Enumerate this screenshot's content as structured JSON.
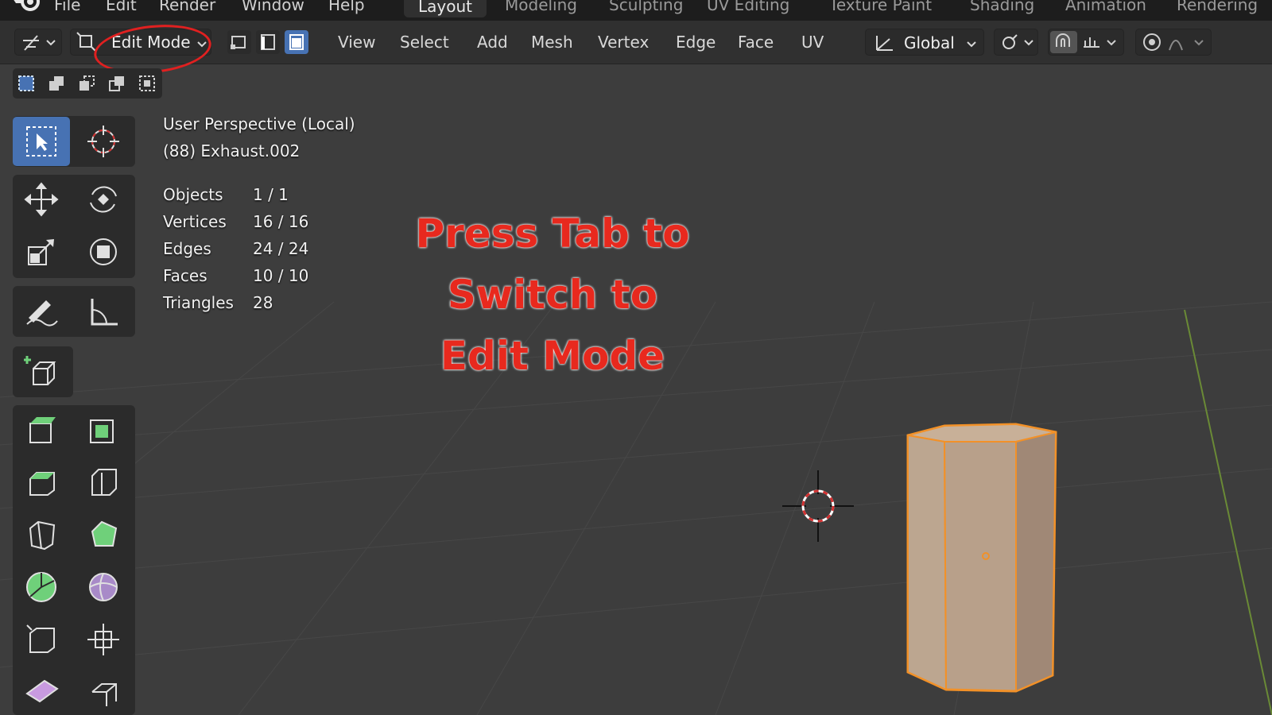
{
  "topbar": {
    "menus": [
      "File",
      "Edit",
      "Render",
      "Window",
      "Help"
    ],
    "workspaces": [
      "Layout",
      "Modeling",
      "Sculpting",
      "UV Editing",
      "Texture Paint",
      "Shading",
      "Animation",
      "Rendering"
    ],
    "active_workspace": "Layout"
  },
  "header": {
    "mode": "Edit Mode",
    "menus": [
      "View",
      "Select",
      "Add",
      "Mesh",
      "Vertex",
      "Edge",
      "Face",
      "UV"
    ],
    "transform_orientation": "Global"
  },
  "overlay": {
    "view_name": "User Perspective (Local)",
    "object_name": "(88) Exhaust.002",
    "stats": [
      {
        "label": "Objects",
        "value": "1 / 1"
      },
      {
        "label": "Vertices",
        "value": "16 / 16"
      },
      {
        "label": "Edges",
        "value": "24 / 24"
      },
      {
        "label": "Faces",
        "value": "10 / 10"
      },
      {
        "label": "Triangles",
        "value": "28"
      }
    ]
  },
  "annotation": {
    "lines": [
      "Press Tab to",
      "Switch to",
      "Edit Mode"
    ],
    "color": "#e8291e"
  },
  "colors": {
    "accent": "#4772b3",
    "selection_orange": "#f29128",
    "viewport_bg": "#3d3d3d",
    "highlight_circle": "#e02020"
  },
  "toolbar": {
    "tools": [
      "select-box-icon",
      "cursor-icon",
      "move-icon",
      "rotate-icon",
      "scale-icon",
      "transform-icon",
      "annotate-icon",
      "measure-icon",
      "add-cube-icon",
      "extrude-icon",
      "inset-icon",
      "bevel-icon",
      "loop-cut-icon",
      "knife-icon",
      "poly-build-icon",
      "spin-icon",
      "smooth-icon",
      "edge-slide-icon",
      "shrink-fatten-icon",
      "shear-icon",
      "rip-icon"
    ]
  }
}
